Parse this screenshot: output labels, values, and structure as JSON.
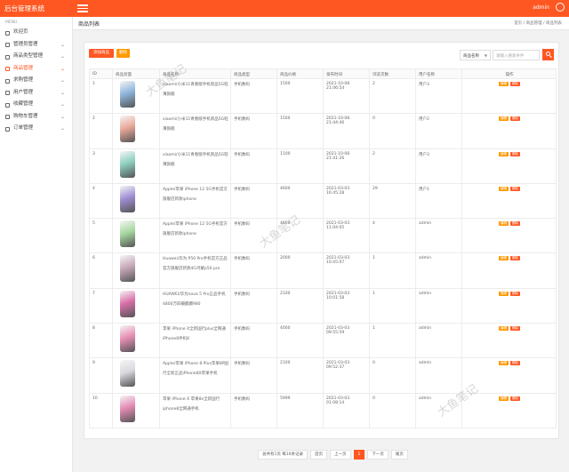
{
  "app": {
    "title": "后台管理系统",
    "user": "admin"
  },
  "sidebar": {
    "header": "MENU",
    "items": [
      {
        "label": "欢迎页",
        "icon": "home-icon",
        "active": false,
        "expandable": false
      },
      {
        "label": "管理员管理",
        "icon": "admin-icon",
        "active": false,
        "expandable": true
      },
      {
        "label": "商品类型管理",
        "icon": "category-icon",
        "active": false,
        "expandable": true
      },
      {
        "label": "商品管理",
        "icon": "goods-icon",
        "active": true,
        "expandable": true
      },
      {
        "label": "求购管理",
        "icon": "purchase-icon",
        "active": false,
        "expandable": true
      },
      {
        "label": "用户管理",
        "icon": "user-icon",
        "active": false,
        "expandable": true
      },
      {
        "label": "收藏管理",
        "icon": "heart-icon",
        "active": false,
        "expandable": true
      },
      {
        "label": "购物车管理",
        "icon": "cart-icon",
        "active": false,
        "expandable": true
      },
      {
        "label": "订单管理",
        "icon": "order-icon",
        "active": false,
        "expandable": true
      }
    ]
  },
  "breadcrumb": {
    "title": "商品列表",
    "items": [
      "首页",
      "/",
      "商品管理",
      "/",
      "商品列表"
    ]
  },
  "toolbar": {
    "add_label": "添加商品",
    "delete_label": "删除",
    "select_value": "商品名称",
    "search_placeholder": "请输入搜索条件"
  },
  "table": {
    "headers": [
      "ID",
      "商品封面",
      "商品名称",
      "商品类型",
      "商品价格",
      "发布时间",
      "浏览次数",
      "用户名称",
      "操作"
    ],
    "edit_label": "编辑",
    "delete_label": "删除",
    "rows": [
      {
        "id": "1",
        "name": "xiaomi/小米11青春版手机新品5G轻薄旗舰",
        "type": "手机数码",
        "price": "1500",
        "time": "2021-10-08 21:46:54",
        "views": "2",
        "user": "用户3",
        "color": "#8fb6dc"
      },
      {
        "id": "2",
        "name": "xiaomi/小米11青春版手机新品5G轻薄旗舰",
        "type": "手机数码",
        "price": "1500",
        "time": "2021-10-08 21:44:46",
        "views": "0",
        "user": "用户2",
        "color": "#e9a89a"
      },
      {
        "id": "3",
        "name": "xiaomi/小米11青春版手机新品5G轻薄旗舰",
        "type": "手机数码",
        "price": "1100",
        "time": "2021-10-08 21:41:26",
        "views": "2",
        "user": "用户3",
        "color": "#8ecfc0"
      },
      {
        "id": "4",
        "name": "Apple/苹果 iPhone 12 5G手机官方旗舰店新款iphone",
        "type": "手机数码",
        "price": "4600",
        "time": "2021-03-03 16:45:28",
        "views": "29",
        "user": "用户1",
        "color": "#9f8fd4"
      },
      {
        "id": "5",
        "name": "Apple/苹果 iPhone 12 5G手机官方旗舰店新款iphone",
        "type": "手机数码",
        "price": "4600",
        "time": "2021-03-03 11:04:05",
        "views": "4",
        "user": "admin",
        "color": "#a7d8a0"
      },
      {
        "id": "6",
        "name": "Huawei/华为 P50 Pro手机官方正品官方旗舰店新款4G鸿蒙p50 pro",
        "type": "手机数码",
        "price": "2000",
        "time": "2021-03-03 10:45:07",
        "views": "1",
        "user": "admin",
        "color": "#c9a9b9"
      },
      {
        "id": "7",
        "name": "HUAWEI/华为nova 5 Pro正品手机4800万四摄麒麟980",
        "type": "手机数码",
        "price": "2100",
        "time": "2021-03-03 10:01:58",
        "views": "1",
        "user": "admin",
        "color": "#d86fa8"
      },
      {
        "id": "8",
        "name": "苹果 iPhone X全新国行plus全网通iPhone8手机8",
        "type": "手机数码",
        "price": "4000",
        "time": "2021-03-03 09:55:59",
        "views": "1",
        "user": "admin",
        "color": "#e78fb5"
      },
      {
        "id": "9",
        "name": "Apple/苹果 iPhone 8 Plus苹果8P国行全新正品iPhone8X苹果手机",
        "type": "手机数码",
        "price": "2100",
        "time": "2021-03-03 09:52:37",
        "views": "0",
        "user": "admin",
        "color": "#d9d9df"
      },
      {
        "id": "10",
        "name": "苹果 iPhone X 苹果8x全新国行iphone8全网通手机",
        "type": "手机数码",
        "price": "5999",
        "time": "2021-03-03 01:08:14",
        "views": "0",
        "user": "admin",
        "color": "#e48bb4"
      }
    ]
  },
  "pagination": {
    "summary": "总共有1页 每10条记录",
    "first": "首页",
    "prev": "上一页",
    "current": "1",
    "next": "下一页",
    "last": "尾页"
  },
  "watermark": "大鱼笔记",
  "colors": {
    "primary": "#ff5722",
    "warning": "#ff9800"
  }
}
